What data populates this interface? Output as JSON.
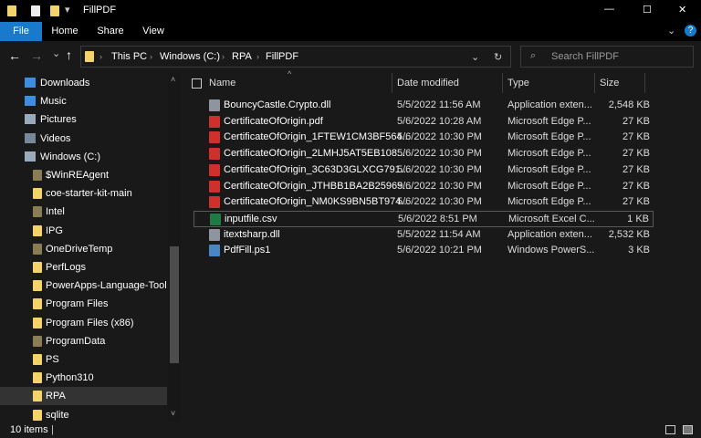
{
  "window": {
    "title": "FillPDF",
    "minimize": "—",
    "maximize": "☐",
    "close": "✕"
  },
  "ribbon": {
    "tabs": [
      "File",
      "Home",
      "Share",
      "View"
    ],
    "accent": "#1979ca",
    "collapse": "⌄",
    "help": "?"
  },
  "nav": {
    "back": "←",
    "forward": "→",
    "recent": "⌄",
    "up": "↑",
    "breadcrumb": [
      "This PC",
      "Windows (C:)",
      "RPA",
      "FillPDF"
    ],
    "dropdown": "⌄",
    "refresh": "↻",
    "search_placeholder": "Search FillPDF",
    "search_icon": "⌕"
  },
  "sidebar": {
    "items": [
      {
        "label": "Downloads",
        "icon": "download-icon"
      },
      {
        "label": "Music",
        "icon": "music-icon"
      },
      {
        "label": "Pictures",
        "icon": "pictures-icon"
      },
      {
        "label": "Videos",
        "icon": "videos-icon"
      },
      {
        "label": "Windows (C:)",
        "icon": "drive-icon"
      },
      {
        "label": "$WinREAgent",
        "icon": "folder-icon",
        "dim": true
      },
      {
        "label": "coe-starter-kit-main",
        "icon": "folder-icon"
      },
      {
        "label": "Intel",
        "icon": "folder-icon",
        "dim": true
      },
      {
        "label": "IPG",
        "icon": "folder-icon"
      },
      {
        "label": "OneDriveTemp",
        "icon": "folder-icon",
        "dim": true
      },
      {
        "label": "PerfLogs",
        "icon": "folder-icon"
      },
      {
        "label": "PowerApps-Language-Tooling",
        "icon": "folder-icon"
      },
      {
        "label": "Program Files",
        "icon": "folder-icon"
      },
      {
        "label": "Program Files (x86)",
        "icon": "folder-icon"
      },
      {
        "label": "ProgramData",
        "icon": "folder-icon",
        "dim": true
      },
      {
        "label": "PS",
        "icon": "folder-icon"
      },
      {
        "label": "Python310",
        "icon": "folder-icon"
      },
      {
        "label": "RPA",
        "icon": "folder-icon",
        "selected": true
      },
      {
        "label": "sqlite",
        "icon": "folder-icon"
      }
    ]
  },
  "columns": {
    "name": "Name",
    "date": "Date modified",
    "type": "Type",
    "size": "Size",
    "sort_indicator": "^"
  },
  "files": [
    {
      "name": "BouncyCastle.Crypto.dll",
      "date": "5/5/2022 11:56 AM",
      "type": "Application exten...",
      "size": "2,548 KB",
      "kind": "dll"
    },
    {
      "name": "CertificateOfOrigin.pdf",
      "date": "5/6/2022 10:28 AM",
      "type": "Microsoft Edge P...",
      "size": "27 KB",
      "kind": "pdf"
    },
    {
      "name": "CertificateOfOrigin_1FTEW1CM3BF564...",
      "date": "5/6/2022 10:30 PM",
      "type": "Microsoft Edge P...",
      "size": "27 KB",
      "kind": "pdf"
    },
    {
      "name": "CertificateOfOrigin_2LMHJ5AT5EB108...",
      "date": "5/6/2022 10:30 PM",
      "type": "Microsoft Edge P...",
      "size": "27 KB",
      "kind": "pdf"
    },
    {
      "name": "CertificateOfOrigin_3C63D3GLXCG791...",
      "date": "5/6/2022 10:30 PM",
      "type": "Microsoft Edge P...",
      "size": "27 KB",
      "kind": "pdf"
    },
    {
      "name": "CertificateOfOrigin_JTHBB1BA2B25969...",
      "date": "5/6/2022 10:30 PM",
      "type": "Microsoft Edge P...",
      "size": "27 KB",
      "kind": "pdf"
    },
    {
      "name": "CertificateOfOrigin_NM0KS9BN5BT974...",
      "date": "5/6/2022 10:30 PM",
      "type": "Microsoft Edge P...",
      "size": "27 KB",
      "kind": "pdf"
    },
    {
      "name": "inputfile.csv",
      "date": "5/6/2022 8:51 PM",
      "type": "Microsoft Excel C...",
      "size": "1 KB",
      "kind": "csv",
      "focused": true
    },
    {
      "name": "itextsharp.dll",
      "date": "5/5/2022 11:54 AM",
      "type": "Application exten...",
      "size": "2,532 KB",
      "kind": "dll"
    },
    {
      "name": "PdfFill.ps1",
      "date": "5/6/2022 10:21 PM",
      "type": "Windows PowerS...",
      "size": "3 KB",
      "kind": "ps1"
    }
  ],
  "status": {
    "count": "10 items"
  }
}
